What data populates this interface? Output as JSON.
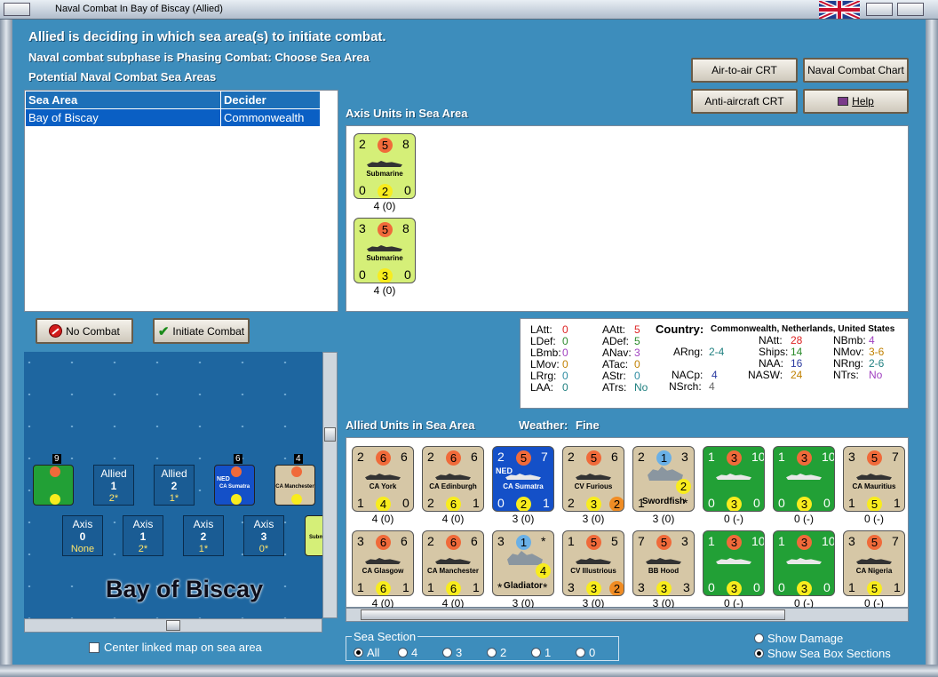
{
  "window": {
    "title": "Naval Combat In Bay of Biscay (Allied)"
  },
  "header": {
    "line1": "Allied is deciding in which sea area(s) to initiate combat.",
    "line2": "Naval combat subphase is Phasing Combat: Choose Sea Area",
    "line3": "Potential Naval Combat Sea Areas"
  },
  "buttons": {
    "air_to_air": "Air-to-air CRT",
    "naval_chart": "Naval Combat Chart",
    "anti_aircraft": "Anti-aircraft CRT",
    "help": "Help",
    "no_combat": "No Combat",
    "initiate": "Initiate Combat"
  },
  "sea_table": {
    "headers": [
      "Sea Area",
      "Decider"
    ],
    "rows": [
      [
        "Bay of Biscay",
        "Commonwealth"
      ]
    ]
  },
  "axis_section": {
    "label": "Axis Units in Sea Area",
    "units": [
      {
        "name": "Submarine",
        "tl": "2",
        "tc": "5",
        "tr": "8",
        "bl": "0",
        "bc": "2",
        "br": "0",
        "strength": "4 (0)"
      },
      {
        "name": "Submarine",
        "tl": "3",
        "tc": "5",
        "tr": "8",
        "bl": "0",
        "bc": "3",
        "br": "0",
        "strength": "4 (0)"
      }
    ]
  },
  "stats": {
    "col1": [
      [
        "LAtt:",
        "0"
      ],
      [
        "LDef:",
        "0"
      ],
      [
        "LBmb:",
        "0"
      ],
      [
        "LMov:",
        "0"
      ],
      [
        "LRrg:",
        "0"
      ],
      [
        "LAA:",
        "0"
      ]
    ],
    "col2": [
      [
        "AAtt:",
        "5"
      ],
      [
        "ADef:",
        "5"
      ],
      [
        "ANav:",
        "3"
      ],
      [
        "ATac:",
        "0"
      ],
      [
        "AStr:",
        "0"
      ],
      [
        "ATrs:",
        "No"
      ]
    ],
    "country_label": "Country:",
    "country_value": "Commonwealth, Netherlands, United States",
    "arng": [
      "ARng:",
      "2-4"
    ],
    "nacp": [
      "NACp:",
      "4"
    ],
    "nsrch": [
      "NSrch:",
      "4"
    ],
    "col4": [
      [
        "NAtt:",
        "28"
      ],
      [
        "Ships:",
        "14"
      ],
      [
        "NAA:",
        "16"
      ],
      [
        "NASW:",
        "24"
      ]
    ],
    "col5": [
      [
        "NBmb:",
        "4"
      ],
      [
        "NMov:",
        "3-6"
      ],
      [
        "NRng:",
        "2-6"
      ],
      [
        "NTrs:",
        "No"
      ]
    ]
  },
  "allied_section": {
    "label": "Allied Units in Sea Area",
    "weather_label": "Weather:",
    "weather_value": "Fine",
    "row1": [
      {
        "name": "CA York",
        "tl": "2",
        "tc": "6",
        "tr": "6",
        "bl": "1",
        "bc": "4",
        "br": "0",
        "strength": "4 (0)",
        "color": "#d6c7a6"
      },
      {
        "name": "CA Edinburgh",
        "tl": "2",
        "tc": "6",
        "tr": "6",
        "bl": "2",
        "bc": "6",
        "br": "1",
        "strength": "4 (0)",
        "color": "#d6c7a6"
      },
      {
        "name": "CA Sumatra",
        "tl": "2",
        "tc": "5",
        "tr": "7",
        "bl": "0",
        "bc": "2",
        "br": "1",
        "strength": "3 (0)",
        "color": "#1450c8",
        "tag": "NED"
      },
      {
        "name": "CV Furious",
        "tl": "2",
        "tc": "5",
        "tr": "6",
        "bl": "2",
        "bc": "3",
        "br": "2",
        "strength": "3 (0)",
        "color": "#d6c7a6"
      },
      {
        "name": "Swordfish",
        "tl": "2",
        "tc": "1",
        "tr": "3",
        "bl": "1",
        "bc": "2",
        "br": "*",
        "strength": "3 (0)",
        "color": "#d6c7a6"
      },
      {
        "name": "",
        "tl": "1",
        "tc": "3",
        "tr": "10",
        "bl": "0",
        "bc": "3",
        "br": "0",
        "strength": "0 (-)",
        "color": "#22a036"
      },
      {
        "name": "",
        "tl": "1",
        "tc": "3",
        "tr": "10",
        "bl": "0",
        "bc": "3",
        "br": "0",
        "strength": "0 (-)",
        "color": "#22a036"
      },
      {
        "name": "CA Mauritius",
        "tl": "3",
        "tc": "5",
        "tr": "7",
        "bl": "1",
        "bc": "5",
        "br": "1",
        "strength": "0 (-)",
        "color": "#d6c7a6"
      }
    ],
    "row2": [
      {
        "name": "CA Glasgow",
        "tl": "3",
        "tc": "6",
        "tr": "6",
        "bl": "1",
        "bc": "6",
        "br": "1",
        "strength": "4 (0)",
        "color": "#d6c7a6"
      },
      {
        "name": "CA Manchester",
        "tl": "2",
        "tc": "6",
        "tr": "6",
        "bl": "1",
        "bc": "6",
        "br": "1",
        "strength": "4 (0)",
        "color": "#d6c7a6"
      },
      {
        "name": "Gladiator",
        "tl": "3",
        "tc": "1",
        "tr": "*",
        "bl": "*",
        "bc": "4",
        "br": "*",
        "strength": "3 (0)",
        "color": "#d6c7a6"
      },
      {
        "name": "CV Illustrious",
        "tl": "1",
        "tc": "5",
        "tr": "5",
        "bl": "3",
        "bc": "3",
        "br": "2",
        "strength": "3 (0)",
        "color": "#d6c7a6"
      },
      {
        "name": "BB Hood",
        "tl": "7",
        "tc": "5",
        "tr": "3",
        "bl": "3",
        "bc": "3",
        "br": "3",
        "strength": "3 (0)",
        "color": "#d6c7a6"
      },
      {
        "name": "",
        "tl": "1",
        "tc": "3",
        "tr": "10",
        "bl": "0",
        "bc": "3",
        "br": "0",
        "strength": "0 (-)",
        "color": "#22a036"
      },
      {
        "name": "",
        "tl": "1",
        "tc": "3",
        "tr": "10",
        "bl": "0",
        "bc": "3",
        "br": "0",
        "strength": "0 (-)",
        "color": "#22a036"
      },
      {
        "name": "CA Nigeria",
        "tl": "3",
        "tc": "5",
        "tr": "7",
        "bl": "1",
        "bc": "5",
        "br": "1",
        "strength": "0 (-)",
        "color": "#d6c7a6"
      }
    ]
  },
  "map": {
    "area_name": "Bay of Biscay",
    "allied_boxes": [
      {
        "side": "Allied",
        "num": "1",
        "val": "2*"
      },
      {
        "side": "Allied",
        "num": "2",
        "val": "1*"
      }
    ],
    "axis_boxes": [
      {
        "side": "Axis",
        "num": "0",
        "val": "None"
      },
      {
        "side": "Axis",
        "num": "1",
        "val": "2*"
      },
      {
        "side": "Axis",
        "num": "2",
        "val": "1*"
      },
      {
        "side": "Axis",
        "num": "3",
        "val": "0*"
      }
    ],
    "stack_counts": [
      "9",
      "6",
      "4"
    ],
    "stack_labels": [
      "CA Sumatra",
      "CA Manchester",
      "Subm"
    ],
    "stack_tag": "NED"
  },
  "center_map": "Center linked map on sea area",
  "sea_section": {
    "label": "Sea Section",
    "options": [
      "All",
      "4",
      "3",
      "2",
      "1",
      "0"
    ]
  },
  "view": {
    "show_damage": "Show Damage",
    "show_sections": "Show Sea Box Sections"
  }
}
